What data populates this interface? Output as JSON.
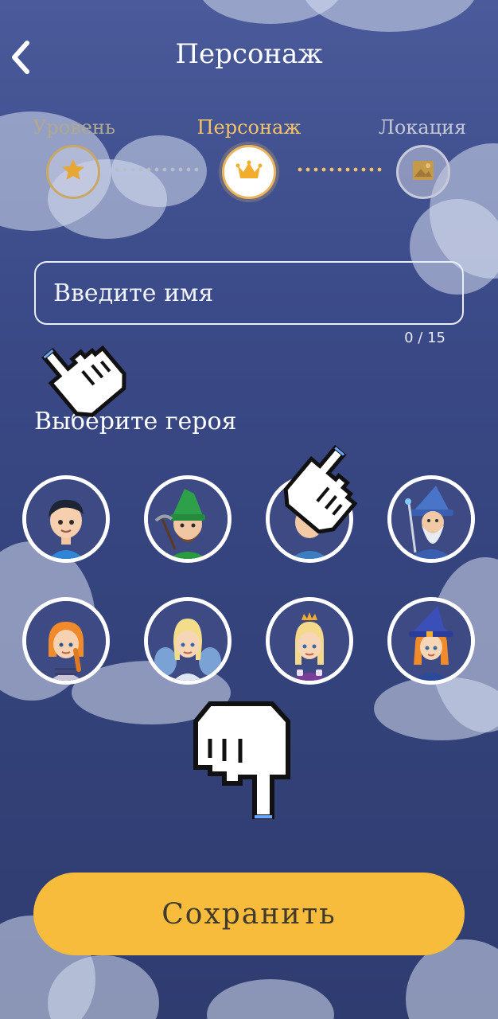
{
  "header": {
    "title": "Персонаж",
    "back_icon": "chevron-left-icon"
  },
  "steps": [
    {
      "label": "Уровень",
      "icon": "star-icon",
      "state": "done"
    },
    {
      "label": "Персонаж",
      "icon": "crown-icon",
      "state": "active"
    },
    {
      "label": "Локация",
      "icon": "image-icon",
      "state": "pending"
    }
  ],
  "name_input": {
    "placeholder": "Введите имя",
    "value": "",
    "counter": "0 / 15"
  },
  "heroes": {
    "heading": "Выберите героя",
    "items": [
      {
        "name": "boy"
      },
      {
        "name": "gnome"
      },
      {
        "name": "knight"
      },
      {
        "name": "wizard"
      },
      {
        "name": "girl"
      },
      {
        "name": "fairy"
      },
      {
        "name": "princess"
      },
      {
        "name": "witch"
      }
    ]
  },
  "save_button": {
    "label": "Сохранить"
  },
  "colors": {
    "accent": "#f8bc3c",
    "step_inactive": "#b0a890",
    "step_active": "#f5c26b",
    "background_top": "#4a5a9a",
    "background_bottom": "#2f3c70"
  }
}
